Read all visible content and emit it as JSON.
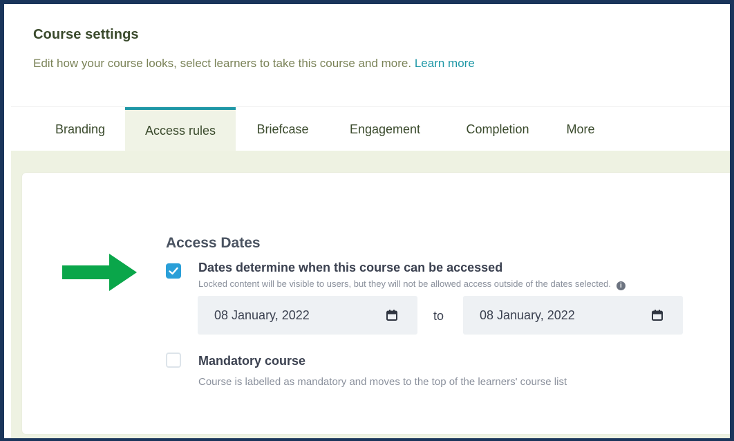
{
  "header": {
    "title": "Course settings",
    "subtitle": "Edit how your course looks, select learners to take this course and more.",
    "learn_more": "Learn more"
  },
  "tabs": [
    {
      "label": "Branding",
      "active": false
    },
    {
      "label": "Access rules",
      "active": true
    },
    {
      "label": "Briefcase",
      "active": false
    },
    {
      "label": "Engagement",
      "active": false
    },
    {
      "label": "Completion",
      "active": false
    },
    {
      "label": "More",
      "active": false
    }
  ],
  "access_dates": {
    "section_title": "Access Dates",
    "dates_option": {
      "checked": true,
      "label": "Dates determine when this course can be accessed",
      "description": "Locked content will be visible to users, but they will not be allowed access outside of the dates selected."
    },
    "start_date": "08 January, 2022",
    "to_label": "to",
    "end_date": "08 January, 2022",
    "mandatory_option": {
      "checked": false,
      "label": "Mandatory course",
      "description": "Course is labelled as mandatory and moves to the top of the learners' course list"
    }
  },
  "colors": {
    "accent": "#1e97a6",
    "checkbox_checked": "#2a9fd8",
    "arrow": "#0aa64a",
    "frame": "#1a355b",
    "content_bg": "#eef2e2"
  },
  "icons": {
    "calendar": "calendar-icon",
    "check": "check-icon",
    "info": "info-icon",
    "arrow": "arrow-right-icon"
  }
}
